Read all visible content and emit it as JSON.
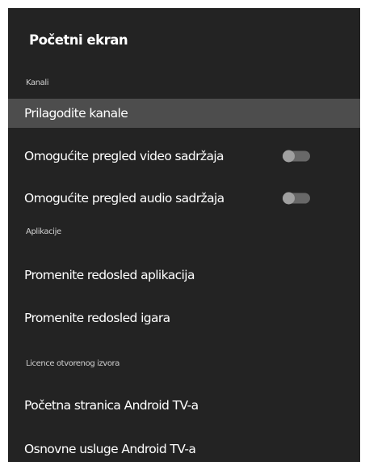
{
  "screen": {
    "title": "Početni ekran"
  },
  "sections": {
    "channels": "Kanali",
    "apps": "Aplikacije",
    "licenses": "Licence otvorenog izvora"
  },
  "items": {
    "customize_channels": "Prilagodite kanale",
    "enable_video_preview": "Omogućite pregled video sadržaja",
    "enable_audio_preview": "Omogućite pregled audio sadržaja",
    "reorder_apps": "Promenite redosled aplikacija",
    "reorder_games": "Promenite redosled igara",
    "android_tv_home": "Početna stranica Android TV-a",
    "android_tv_core_services": "Osnovne usluge Android TV-a"
  },
  "toggles": {
    "video_preview_enabled": false,
    "audio_preview_enabled": false
  },
  "colors": {
    "panel_background": "#232323",
    "focused_row": "#4d4d4d",
    "toggle_track": "#686868",
    "toggle_knob": "#a0a0a0"
  }
}
